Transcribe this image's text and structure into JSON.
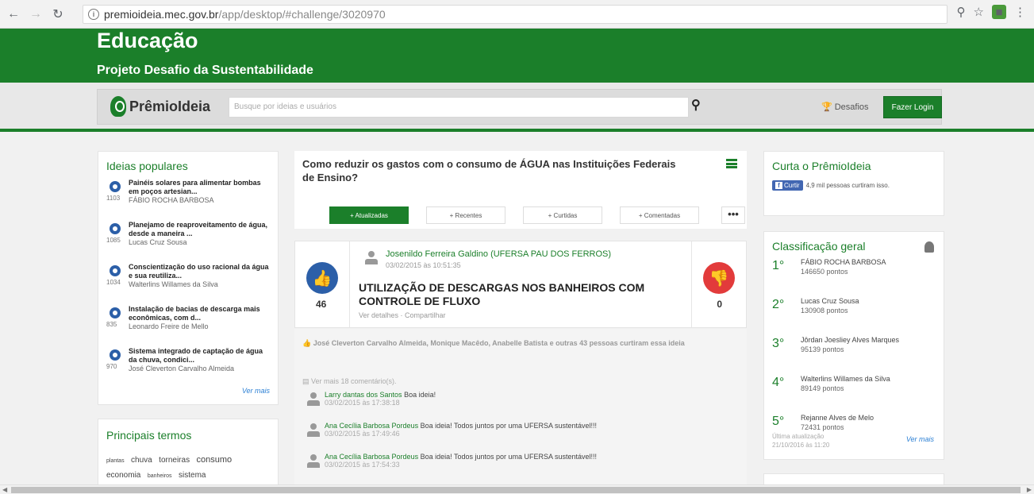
{
  "browser": {
    "url_domain": "premioideia.mec.gov.br",
    "url_path": "/app/desktop/#challenge/3020970"
  },
  "header": {
    "title": "Educação",
    "subtitle": "Projeto Desafio da Sustentabilidade"
  },
  "topbar": {
    "logo": "PrêmioIdeia",
    "search_placeholder": "Busque por ideias e usuários",
    "challenges_label": "Desafios",
    "login_label": "Fazer Login"
  },
  "popular": {
    "title": "Ideias populares",
    "items": [
      {
        "count": "1103",
        "title": "Painéis solares para alimentar bombas em poços artesian...",
        "author": "FÁBIO ROCHA BARBOSA"
      },
      {
        "count": "1085",
        "title": "Planejamo de reaproveitamento de água, desde a maneira ...",
        "author": "Lucas Cruz Sousa"
      },
      {
        "count": "1034",
        "title": "Conscientização do uso racional da água e sua reutiliza...",
        "author": "Walterlins Willames da Silva"
      },
      {
        "count": "835",
        "title": "Instalação de bacias de descarga mais econômicas, com d...",
        "author": "Leonardo Freire de Mello"
      },
      {
        "count": "970",
        "title": "Sistema integrado de captação de água da chuva, condici...",
        "author": "José Cleverton Carvalho Almeida"
      }
    ],
    "see_more": "Ver mais"
  },
  "terms": {
    "title": "Principais termos",
    "words": [
      "plantas",
      "chuva",
      "torneiras",
      "consumo",
      "economia",
      "banheiros",
      "sistema"
    ]
  },
  "challenge": {
    "title": "Como reduzir os gastos com o consumo de ÁGUA nas Instituições Federais de Ensino?",
    "filters": [
      "+ Atualizadas",
      "+ Recentes",
      "+ Curtidas",
      "+ Comentadas"
    ],
    "more": "•••"
  },
  "idea": {
    "up_count": "46",
    "down_count": "0",
    "author": "Josenildo Ferreira Galdino (UFERSA PAU DOS FERROS)",
    "date": "03/02/2015 às 10:51:35",
    "title": "UTILIZAÇÃO DE DESCARGAS NOS BANHEIROS COM CONTROLE DE FLUXO",
    "links": "Ver detalhes · Compartilhar",
    "likers": "José Cleverton Carvalho Almeida, Monique Macêdo, Anabelle Batista e outras 43 pessoas curtiram essa ideia"
  },
  "comments": {
    "see_more": "Ver mais 18 comentário(s).",
    "items": [
      {
        "name": "Larry dantas dos Santos",
        "text": "Boa ideia!",
        "date": "03/02/2015 às 17:38:18"
      },
      {
        "name": "Ana Cecília Barbosa Pordeus",
        "text": "Boa ideia! Todos juntos por uma UFERSA sustentável!!!",
        "date": "03/02/2015 às 17:49:46"
      },
      {
        "name": "Ana Cecília Barbosa Pordeus",
        "text": "Boa ideia! Todos juntos por uma UFERSA sustentável!!!",
        "date": "03/02/2015 às 17:54:33"
      }
    ]
  },
  "like_card": {
    "title": "Curta o PrêmioIdeia",
    "button": "Curtir",
    "text": "4,9 mil pessoas curtiram isso."
  },
  "ranking": {
    "title": "Classificação geral",
    "items": [
      {
        "pos": "1°",
        "name": "FÁBIO ROCHA BARBOSA",
        "points": "146650 pontos"
      },
      {
        "pos": "2°",
        "name": "Lucas Cruz Sousa",
        "points": "130908 pontos"
      },
      {
        "pos": "3°",
        "name": "Jôrdan Joesliey Alves Marques",
        "points": "95139 pontos"
      },
      {
        "pos": "4°",
        "name": "Walterlins Willames da Silva",
        "points": "89149 pontos"
      },
      {
        "pos": "5°",
        "name": "Rejanne Alves de Melo",
        "points": "72431 pontos"
      }
    ],
    "updated_label": "Última atualização",
    "updated_value": "21/10/2016 às 11:20",
    "see_more": "Ver mais"
  },
  "colors": {
    "brand_green": "#1b7f2a",
    "like_blue": "#2c5fa8",
    "dislike_red": "#e23b3b"
  }
}
